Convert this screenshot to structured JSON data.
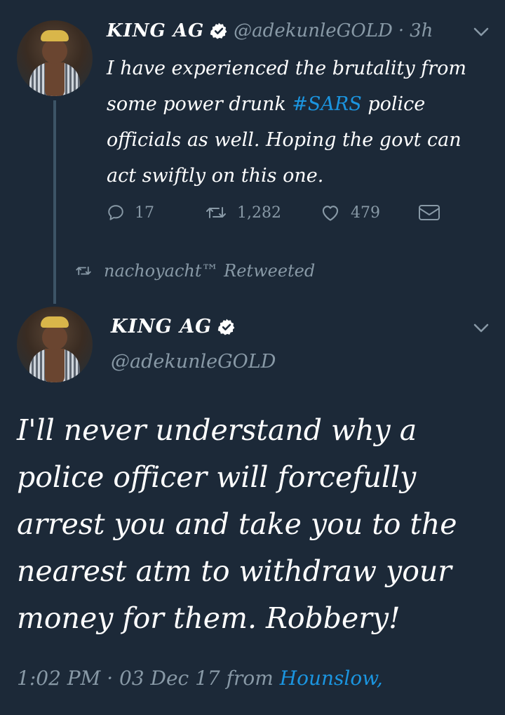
{
  "tweet1": {
    "name": "KING AG",
    "handle": "@adekunleGOLD",
    "separator": "·",
    "time": "3h",
    "text_before": "I have experienced the brutality from some power drunk ",
    "hashtag": "#SARS",
    "text_after": " police officials as well. Hoping the govt can act swiftly on this one.",
    "replies": "17",
    "retweets": "1,282",
    "likes": "479"
  },
  "retweet_context": {
    "text": "nachoyacht™ Retweeted"
  },
  "tweet2": {
    "name": "KING AG",
    "handle": "@adekunleGOLD",
    "text": "I'll never understand why a police officer will forcefully arrest you and take you to the nearest atm to withdraw your money for them. Robbery!",
    "timestamp": "1:02 PM · 03 Dec 17 from ",
    "location": "Hounslow,"
  },
  "colors": {
    "background": "#1c2938",
    "text": "#ffffff",
    "muted": "#8899a6",
    "accent": "#1b95e0"
  },
  "icons": [
    "verified-badge-icon",
    "chevron-down-icon",
    "reply-icon",
    "retweet-icon",
    "like-icon",
    "direct-message-icon"
  ]
}
